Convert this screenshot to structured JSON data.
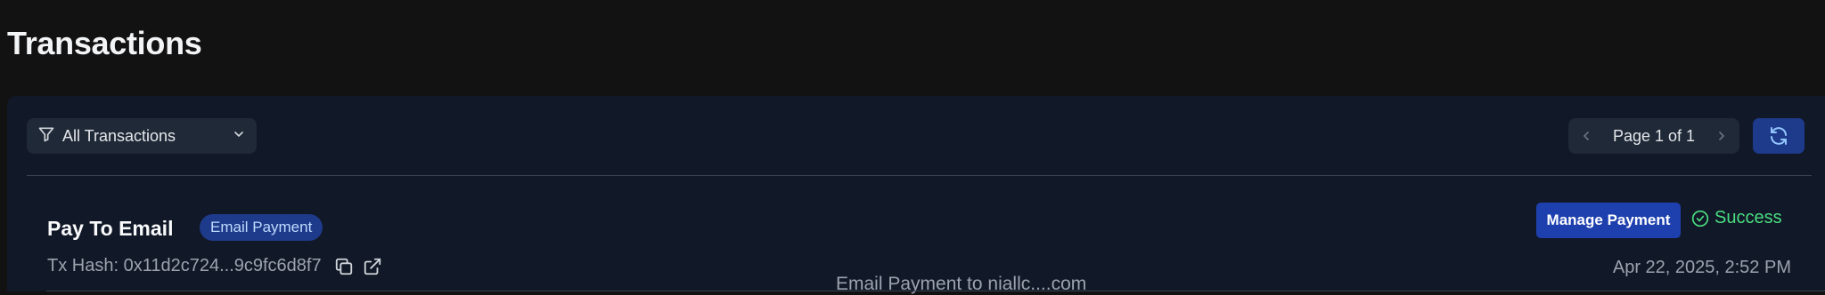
{
  "header": {
    "title": "Transactions"
  },
  "toolbar": {
    "filter": {
      "selected": "All Transactions",
      "icon": "filter-icon"
    },
    "pager": {
      "text": "Page 1 of 1"
    },
    "refresh": {
      "icon": "refresh-icon"
    }
  },
  "transactions": [
    {
      "title": "Pay To Email",
      "type_badge": "Email Payment",
      "tx_hash": "Tx Hash: 0x11d2c724...9c9fc6d8f7",
      "description": "Email Payment to niallc....com",
      "action_label": "Manage Payment",
      "status": "Success",
      "timestamp": "Apr 22, 2025, 2:52 PM"
    }
  ],
  "colors": {
    "background": "#121212",
    "panel": "#111827",
    "accent": "#1e40af",
    "success": "#4ade80",
    "badge_text": "#bfdbfe"
  }
}
